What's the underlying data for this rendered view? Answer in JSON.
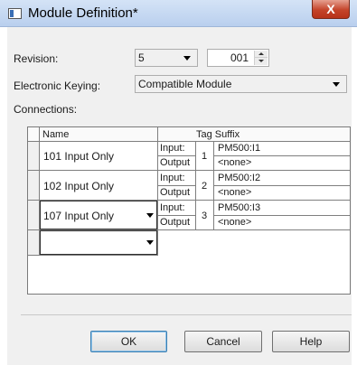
{
  "window": {
    "title": "Module Definition*",
    "close_label": "X"
  },
  "revision": {
    "label": "Revision:",
    "major_value": "5",
    "minor_value": "001"
  },
  "keying": {
    "label": "Electronic Keying:",
    "value": "Compatible Module"
  },
  "connections": {
    "label": "Connections:",
    "headers": {
      "name": "Name",
      "tag_suffix": "Tag Suffix"
    },
    "rows": [
      {
        "name": "101 Input Only",
        "number": "1",
        "input_label": "Input:",
        "output_label": "Output",
        "input_tag": "PM500:I1",
        "output_tag": "<none>"
      },
      {
        "name": "102 Input Only",
        "number": "2",
        "input_label": "Input:",
        "output_label": "Output",
        "input_tag": "PM500:I2",
        "output_tag": "<none>"
      },
      {
        "name": "107 Input Only",
        "number": "3",
        "input_label": "Input:",
        "output_label": "Output",
        "input_tag": "PM500:I3",
        "output_tag": "<none>"
      }
    ]
  },
  "buttons": {
    "ok": "OK",
    "cancel": "Cancel",
    "help": "Help"
  }
}
